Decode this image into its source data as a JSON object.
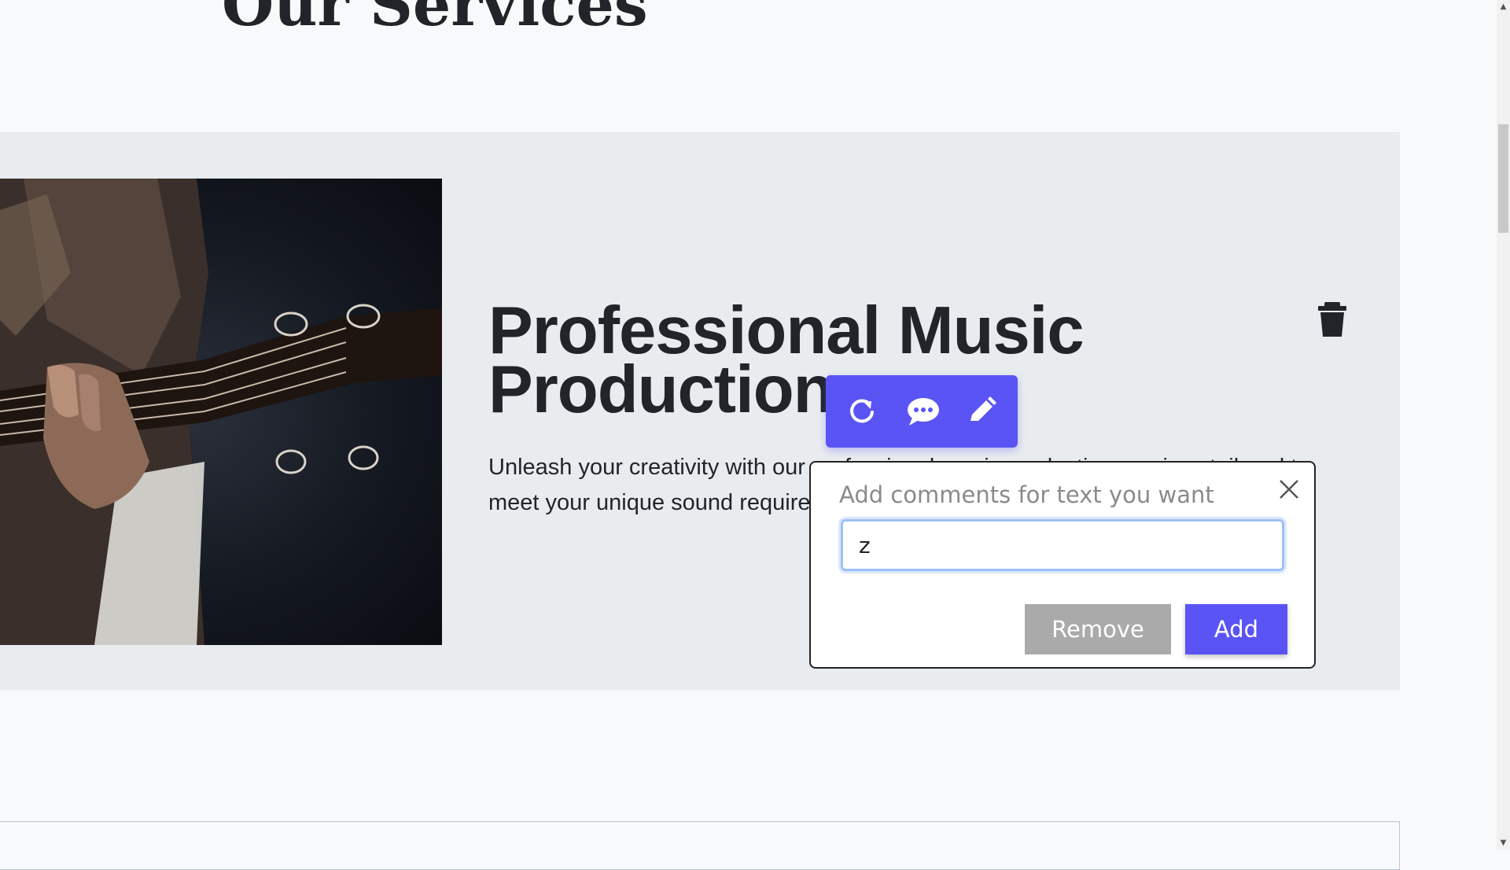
{
  "page": {
    "title": "Our Services"
  },
  "service": {
    "heading": "Professional Music Production",
    "description": "Unleash your creativity with our professional music production services tailored to meet your unique sound requirements."
  },
  "toolbar": {
    "items": [
      {
        "icon": "refresh-icon"
      },
      {
        "icon": "comment-icon"
      },
      {
        "icon": "pencil-icon"
      }
    ],
    "color": "#5a54f5"
  },
  "comment_popup": {
    "label": "Add comments for text you want",
    "input_value": "z",
    "remove_label": "Remove",
    "add_label": "Add"
  },
  "colors": {
    "accent": "#5a54f5",
    "remove_button": "#aaaaaa",
    "card_background": "#e9ecef"
  }
}
